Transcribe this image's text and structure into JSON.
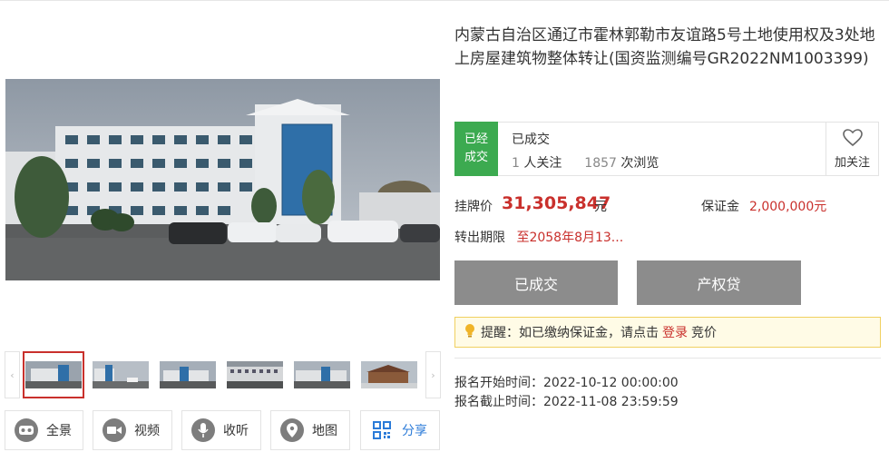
{
  "listing": {
    "title": "内蒙古自治区通辽市霍林郭勒市友谊路5号土地使用权及3处地上房屋建筑物整体转让(国资监测编号GR2022NM1003399)",
    "status_badge": "已经成交",
    "status_text": "已成交",
    "followers_count": "1",
    "followers_label": "人关注",
    "views_count": "1857",
    "views_label": "次浏览",
    "follow_label": "加关注",
    "price_label": "挂牌价",
    "price_value": "31,305,847",
    "price_unit": "元",
    "deposit_label": "保证金",
    "deposit_value": "2,000,000元",
    "period_label": "转出期限",
    "period_value": "至2058年8月13...",
    "primary_button": "已成交",
    "loan_button": "产权贷",
    "reminder_prefix": "提醒：如已缴纳保证金，请点击",
    "reminder_link": "登录",
    "reminder_suffix": "竞价",
    "signup_start_label": "报名开始时间：",
    "signup_start_value": "2022-10-12 00:00:00",
    "signup_end_label": "报名截止时间：",
    "signup_end_value": "2022-11-08 23:59:59"
  },
  "gallery": {
    "arrow_left": "‹",
    "arrow_right": "›",
    "thumbnails": [
      {
        "name": "thumb-1",
        "active": true
      },
      {
        "name": "thumb-2",
        "active": false
      },
      {
        "name": "thumb-3",
        "active": false
      },
      {
        "name": "thumb-4",
        "active": false
      },
      {
        "name": "thumb-5",
        "active": false
      },
      {
        "name": "thumb-6",
        "active": false
      }
    ]
  },
  "actions": [
    {
      "label": "全景",
      "icon": "vr-glasses-icon"
    },
    {
      "label": "视频",
      "icon": "video-camera-icon"
    },
    {
      "label": "收听",
      "icon": "microphone-icon"
    },
    {
      "label": "地图",
      "icon": "map-pin-icon"
    },
    {
      "label": "分享",
      "icon": "qr-code-icon"
    }
  ],
  "colors": {
    "accent_red": "#c9302c",
    "status_green": "#3caa50",
    "button_gray": "#8c8c8c",
    "share_blue": "#2b7bd8"
  }
}
